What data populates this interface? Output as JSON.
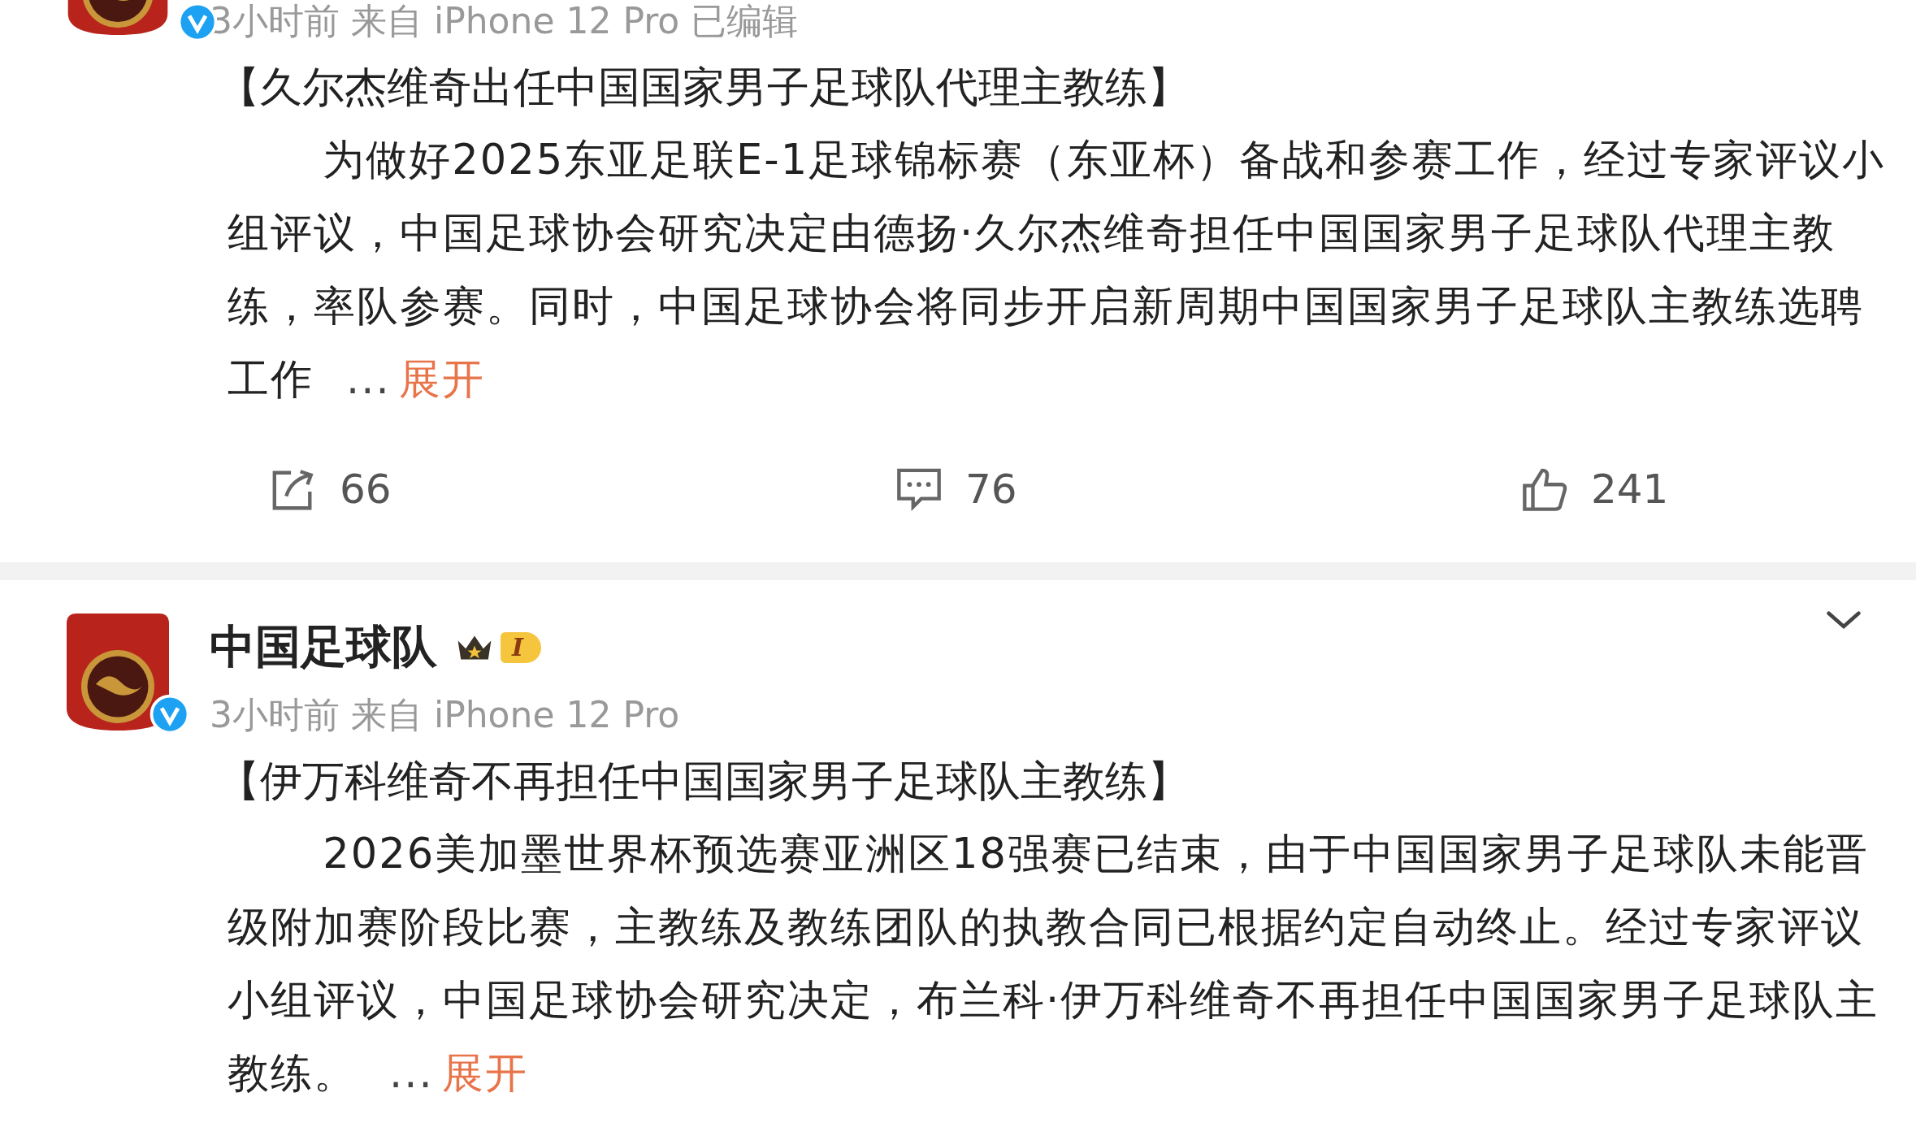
{
  "posts": [
    {
      "meta": "3小时前  来自 iPhone 12 Pro 已编辑",
      "title": "【久尔杰维奇出任中国国家男子足球队代理主教练】",
      "body": "为做好2025东亚足联E-1足球锦标赛（东亚杯）备战和参赛工作，经过专家评议小组评议，中国足球协会研究决定由德扬·久尔杰维奇担任中国国家男子足球队代理主教练，率队参赛。同时，中国足球协会将同步开启新周期中国国家男子足球队主教练选聘工作",
      "ellipsis": "...",
      "expand": "展开",
      "actions": [
        {
          "kind": "share",
          "count": "66"
        },
        {
          "kind": "comment",
          "count": "76"
        },
        {
          "kind": "like",
          "count": "241"
        }
      ]
    },
    {
      "author": "中国足球队",
      "level_badge": "I",
      "meta": "3小时前  来自 iPhone 12 Pro",
      "title": "【伊万科维奇不再担任中国国家男子足球队主教练】",
      "body": "2026美加墨世界杯预选赛亚洲区18强赛已结束，由于中国国家男子足球队未能晋级附加赛阶段比赛，主教练及教练团队的执教合同已根据约定自动终止。经过专家评议小组评议，中国足球协会研究决定，布兰科·伊万科维奇不再担任中国国家男子足球队主教练。",
      "ellipsis": "...",
      "expand": "展开"
    }
  ]
}
